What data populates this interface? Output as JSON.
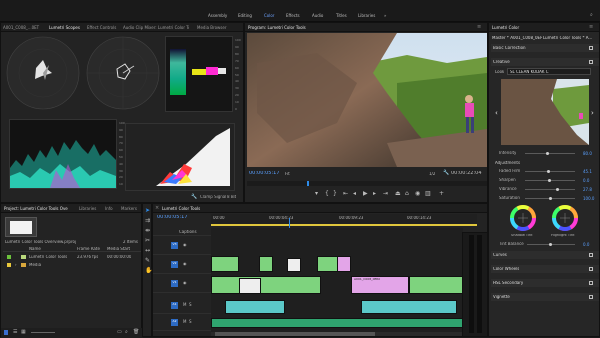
{
  "workspaces": [
    "Assembly",
    "Editing",
    "Color",
    "Effects",
    "Audio",
    "Titles",
    "Libraries"
  ],
  "active_workspace": "Color",
  "scopes_tabs": [
    "A001_C008_...0ET",
    "Lumetri Scopes",
    "Effect Controls",
    "Audio Clip Mixer: Lumetri Color Tools",
    "Media Browser"
  ],
  "scopes_footer": {
    "clamp_label": "Clamp Signal",
    "depth": "8 Bit"
  },
  "parade_scale": [
    "100",
    "90",
    "80",
    "70",
    "60",
    "50",
    "40",
    "30",
    "20",
    "10",
    "0"
  ],
  "program": {
    "tab": "Program: Lumetri Color Tools",
    "timecode": "00:00:05:17",
    "fit": "Fit",
    "quality": "1/2",
    "duration": "00:00:22:04"
  },
  "lumetri": {
    "tab": "Lumetri Color",
    "master": "Master * A001_C008_0ERK...",
    "sequence": "Lumetri Color Tools * A...",
    "basic_correction": "Basic Correction",
    "creative": "Creative",
    "look_label": "Look",
    "look_value": "SL CLEAN KODAK C",
    "intensity_label": "Intensity",
    "intensity_value": "80.0",
    "adjustments": "Adjustments",
    "faded_film_label": "Faded Film",
    "faded_film_value": "45.1",
    "sharpen_label": "Sharpen",
    "sharpen_value": "0.0",
    "vibrance_label": "Vibrance",
    "vibrance_value": "27.8",
    "saturation_label": "Saturation",
    "saturation_value": "100.0",
    "shadow_tint": "Shadow Tint",
    "highlight_tint": "Highlight Tint",
    "tint_balance_label": "Tint Balance",
    "tint_balance_value": "0.0",
    "sections": [
      "Curves",
      "Color Wheels",
      "HSL Secondary",
      "Vignette"
    ]
  },
  "project": {
    "tabs": [
      "Project: Lumetri Color Tools Overview",
      "Libraries",
      "Info",
      "Markers"
    ],
    "file": "Lumetri Color Tools Overview.prproj",
    "items_count": "2 Items",
    "columns": [
      "Name",
      "Frame Rate",
      "Media Start"
    ],
    "rows": [
      {
        "name": "Lumetri Color Tools",
        "rate": "23.976 fps",
        "start": "00:00:00:00"
      },
      {
        "name": "Media",
        "rate": "",
        "start": ""
      }
    ]
  },
  "timeline": {
    "tab": "Lumetri Color Tools",
    "timecode": "00:00:05:17",
    "ruler": [
      "00:00",
      "00:00:04:23",
      "00:00:09:23",
      "00:00:14:23"
    ],
    "tracks": [
      "Captions",
      "V3",
      "V2",
      "V1",
      "A1",
      "A2"
    ],
    "clip_label": "A001_C008_0ERK"
  },
  "colors": {
    "accent": "#2d8ceb",
    "blue_text": "#5aa0ff",
    "clip_cyan": "#5bc8c8",
    "clip_pink": "#e3a5e8",
    "clip_green": "#7ed37e"
  }
}
